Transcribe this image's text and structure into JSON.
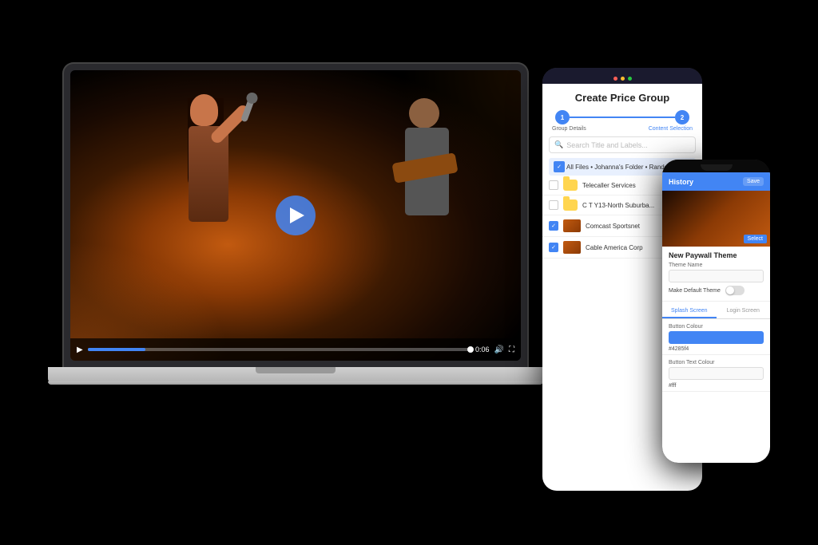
{
  "background": "#000000",
  "laptop": {
    "video": {
      "play_button_label": "▶",
      "progress_percent": 15,
      "time_display": "0:06"
    }
  },
  "tablet": {
    "title": "Create Price Group",
    "steps": [
      {
        "label": "Group Details",
        "number": "1",
        "active": false
      },
      {
        "label": "Content Selection",
        "number": "2",
        "active": true
      }
    ],
    "search_placeholder": "Search Title and Labels...",
    "breadcrumb": "All Files • Johanna's Folder • Random",
    "files": [
      {
        "name": "Telecaller Services",
        "type": "folder",
        "checked": false
      },
      {
        "name": "C T Y13-North Suburba...",
        "type": "folder",
        "checked": false
      },
      {
        "name": "Comcast Sportsnet",
        "type": "video",
        "checked": true
      },
      {
        "name": "Cable America Corp",
        "type": "video",
        "checked": true
      }
    ]
  },
  "phone": {
    "top_bar_title": "History",
    "save_label": "Save",
    "section_title": "New Paywall Theme",
    "theme_name_label": "Theme Name",
    "default_theme_label": "Make Default Theme",
    "button_color_label": "Button Colour",
    "button_color_value": "#4285f4",
    "button_text_color_label": "Button Text Colour",
    "button_text_color_value": "#fff",
    "tabs": [
      {
        "label": "Splash Screen",
        "active": true
      },
      {
        "label": "Login Screen",
        "active": false
      }
    ]
  }
}
